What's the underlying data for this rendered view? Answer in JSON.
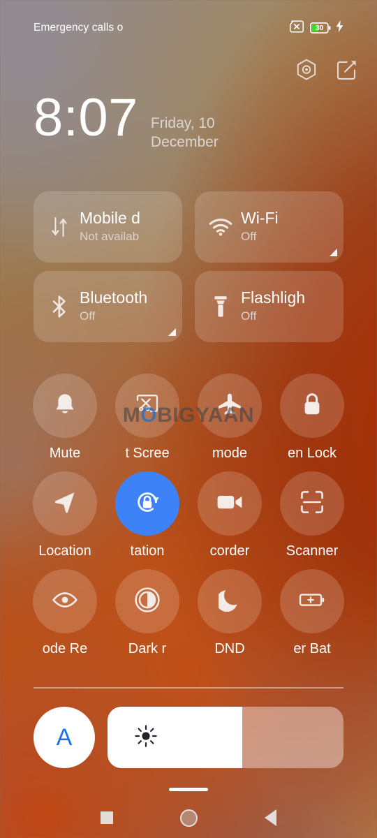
{
  "statusbar": {
    "carrier_text": "Emergency calls o",
    "sim_icon": "sim-card-disabled-icon",
    "battery_level": "30",
    "battery_icon": "battery-icon",
    "charging_icon": "charging-bolt-icon"
  },
  "header": {
    "clock": "8:07",
    "date": "Friday, 10 December",
    "settings_icon": "hexagon-settings-icon",
    "edit_icon": "edit-square-icon"
  },
  "big_tiles": [
    {
      "title": "Mobile d",
      "subtitle": "Not availab",
      "icon": "mobile-data-arrows-icon",
      "has_corner": false,
      "active": false
    },
    {
      "title": "Wi-Fi",
      "subtitle": "Off",
      "icon": "wifi-icon",
      "has_corner": true,
      "active": false
    },
    {
      "title": "Bluetooth",
      "subtitle": "Off",
      "icon": "bluetooth-icon",
      "has_corner": true,
      "active": false
    },
    {
      "title": "Flashligh",
      "subtitle": "Off",
      "icon": "flashlight-icon",
      "has_corner": false,
      "active": false
    }
  ],
  "toggle_rows": [
    [
      {
        "label": "Mute",
        "icon": "bell-icon",
        "active": false
      },
      {
        "label": "t Scree",
        "icon": "cast-screen-off-icon",
        "active": false
      },
      {
        "label": "mode",
        "icon": "airplane-icon",
        "active": false
      },
      {
        "label": "en Lock",
        "icon": "lock-icon",
        "active": false
      }
    ],
    [
      {
        "label": "Location",
        "icon": "location-arrow-icon",
        "active": false
      },
      {
        "label": "tation",
        "icon": "rotation-lock-icon",
        "active": true
      },
      {
        "label": "corder",
        "icon": "video-camera-icon",
        "active": false
      },
      {
        "label": "Scanner",
        "icon": "qr-scanner-icon",
        "active": false
      }
    ],
    [
      {
        "label": "ode  Re",
        "icon": "eye-icon",
        "active": false
      },
      {
        "label": "Dark r",
        "icon": "contrast-circle-icon",
        "active": false
      },
      {
        "label": "DND",
        "icon": "moon-icon",
        "active": false
      },
      {
        "label": "er  Bat",
        "icon": "battery-saver-icon",
        "active": false
      }
    ]
  ],
  "brightness": {
    "auto_label": "A",
    "auto_icon": "auto-brightness-icon",
    "sun_icon": "brightness-sun-icon",
    "fill_percent": 57
  },
  "navbar": {
    "recents_icon": "recents-square-icon",
    "home_icon": "home-circle-icon",
    "back_icon": "back-triangle-icon",
    "drag_handle": "panel-drag-handle"
  },
  "watermark": {
    "prefix": "M",
    "highlight": "O",
    "suffix": "BIGYAAN"
  },
  "colors": {
    "active_tile": "#3e82f7",
    "auto_letter": "#1a73e8",
    "battery_fill": "#3ddc2a",
    "tile_bg": "rgba(255,255,255,0.16)"
  }
}
